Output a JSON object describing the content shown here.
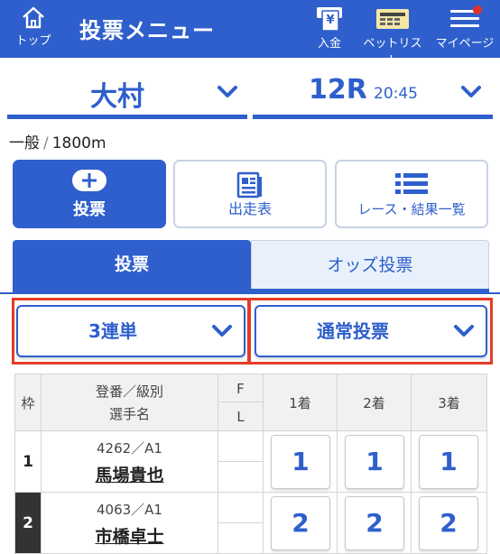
{
  "header": {
    "top_label": "トップ",
    "title": "投票メニュー",
    "deposit_label": "入金",
    "betlist_label": "ベットリスト",
    "mypage_label": "マイページ"
  },
  "race_select": {
    "place": "大村",
    "race_no": "12R",
    "time": "20:45"
  },
  "race_info": {
    "class": "一般",
    "distance": "1800m"
  },
  "menu": {
    "vote": "投票",
    "entry": "出走表",
    "results": "レース・結果一覧"
  },
  "tabs": {
    "vote": "投票",
    "odds_vote": "オッズ投票"
  },
  "dropdowns": {
    "bet_type": "3連単",
    "vote_method": "通常投票"
  },
  "table": {
    "headers": {
      "waku": "枠",
      "racer_line1": "登番／級別",
      "racer_line2": "選手名",
      "f": "F",
      "l": "L",
      "first": "1着",
      "second": "2着",
      "third": "3着"
    },
    "rows": [
      {
        "waku": "1",
        "reg": "4262／A1",
        "name": "馬場貴也",
        "f": "",
        "l": "",
        "b1": "1",
        "b2": "1",
        "b3": "1"
      },
      {
        "waku": "2",
        "reg": "4063／A1",
        "name": "市橋卓士",
        "f": "",
        "l": "",
        "b1": "2",
        "b2": "2",
        "b3": "2"
      }
    ]
  },
  "colors": {
    "brand_blue": "#2e5fcc",
    "highlight_red": "#e63b25"
  }
}
